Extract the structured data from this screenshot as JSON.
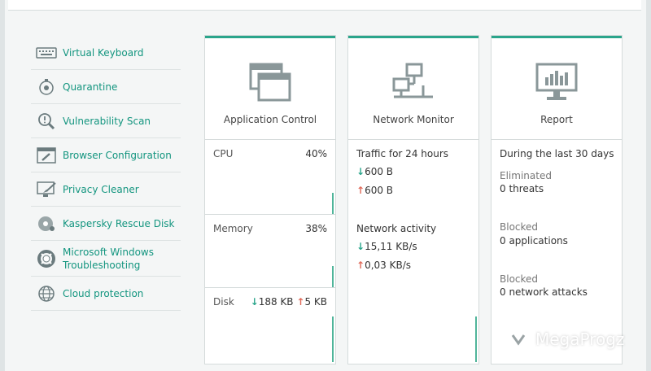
{
  "sidebar": {
    "items": [
      {
        "label": "Virtual Keyboard",
        "icon": "keyboard-icon"
      },
      {
        "label": "Quarantine",
        "icon": "quarantine-icon"
      },
      {
        "label": "Vulnerability Scan",
        "icon": "magnifier-icon"
      },
      {
        "label": "Browser Configuration",
        "icon": "browser-wrench-icon"
      },
      {
        "label": "Privacy Cleaner",
        "icon": "monitor-broom-icon"
      },
      {
        "label": "Kaspersky Rescue Disk",
        "icon": "disc-icon"
      },
      {
        "label": "Microsoft Windows Troubleshooting",
        "icon": "lifebuoy-icon"
      },
      {
        "label": "Cloud protection",
        "icon": "globe-icon"
      }
    ]
  },
  "cards": {
    "app_control": {
      "title": "Application Control",
      "cpu_label": "CPU",
      "cpu_value": "40%",
      "memory_label": "Memory",
      "memory_value": "38%",
      "disk_label": "Disk",
      "disk_down": "188 KB",
      "disk_up": "5 KB"
    },
    "network": {
      "title": "Network Monitor",
      "traffic_label": "Traffic for 24 hours",
      "traffic_down": "600 B",
      "traffic_up": "600 B",
      "activity_label": "Network activity",
      "activity_down": "15,11 KB/s",
      "activity_up": "0,03 KB/s"
    },
    "report": {
      "title": "Report",
      "period": "During the last 30 days",
      "eliminated_label": "Eliminated",
      "eliminated_value": "0 threats",
      "blocked_apps_label": "Blocked",
      "blocked_apps_value": "0 applications",
      "blocked_attacks_label": "Blocked",
      "blocked_attacks_value": "0 network attacks"
    }
  },
  "arrows": {
    "down": "↓",
    "up": "↑"
  },
  "watermark": {
    "text": "MegaProgz"
  },
  "colors": {
    "accent": "#2aa58b",
    "link": "#13957f",
    "up_arrow": "#e06a5a"
  }
}
